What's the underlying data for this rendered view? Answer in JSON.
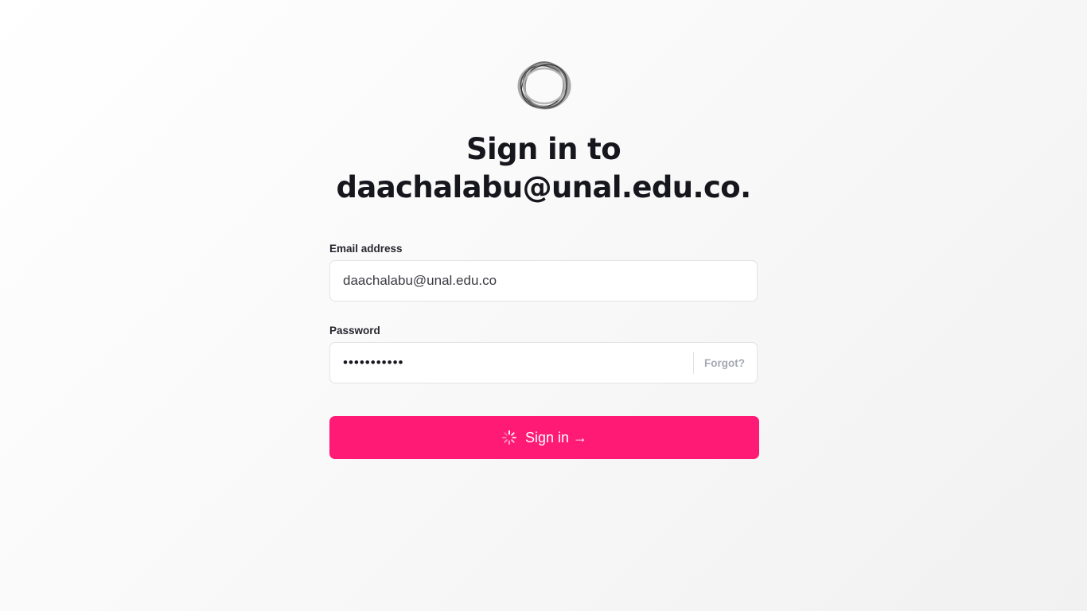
{
  "page": {
    "title_line1": "Sign in to",
    "title_line2": "daachalabu@unal.edu.co."
  },
  "logo": {
    "icon": "ring-logo-icon"
  },
  "form": {
    "email_label": "Email address",
    "email_value": "daachalabu@unal.edu.co",
    "password_label": "Password",
    "password_value": "•••••••••••",
    "forgot_label": "Forgot?",
    "submit_label": "Sign in →",
    "submit_state": "loading"
  },
  "colors": {
    "accent": "#ff1a75",
    "text": "#16161d",
    "muted": "#a3a8b3",
    "background": "#f7f7f7"
  }
}
